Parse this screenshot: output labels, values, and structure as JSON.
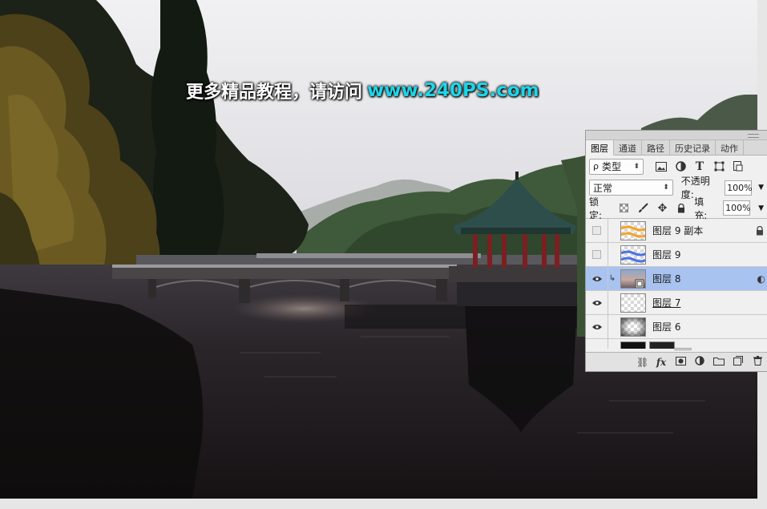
{
  "watermark": {
    "cn_text": "更多精品教程，请访问",
    "url_text": "www.240PS.com"
  },
  "layers_panel": {
    "tabs": [
      {
        "label": "图层",
        "active": true
      },
      {
        "label": "通道",
        "active": false
      },
      {
        "label": "路径",
        "active": false
      },
      {
        "label": "历史记录",
        "active": false
      },
      {
        "label": "动作",
        "active": false
      }
    ],
    "filter": {
      "search_glyph": "ρ",
      "kind_label": "类型"
    },
    "blend_mode": "正常",
    "opacity_label": "不透明度:",
    "opacity_value": "100%",
    "lock_label": "锁定:",
    "fill_label": "填充:",
    "fill_value": "100%",
    "layers": [
      {
        "name": "图层 9 副本",
        "visible": false,
        "selected": false,
        "thumb": "orange-waves",
        "locked": true
      },
      {
        "name": "图层 9",
        "visible": false,
        "selected": false,
        "thumb": "blue-waves"
      },
      {
        "name": "图层 8",
        "visible": true,
        "selected": true,
        "thumb": "sky-photo",
        "clipped": true,
        "smart": true
      },
      {
        "name": "图层 7",
        "visible": true,
        "selected": false,
        "thumb": "transparent",
        "underline": true
      },
      {
        "name": "图层 6",
        "visible": true,
        "selected": false,
        "thumb": "gray-gradient"
      }
    ],
    "colors": {
      "selected_row": "#a8c3f0",
      "panel_bg": "#f0f0f0"
    }
  }
}
